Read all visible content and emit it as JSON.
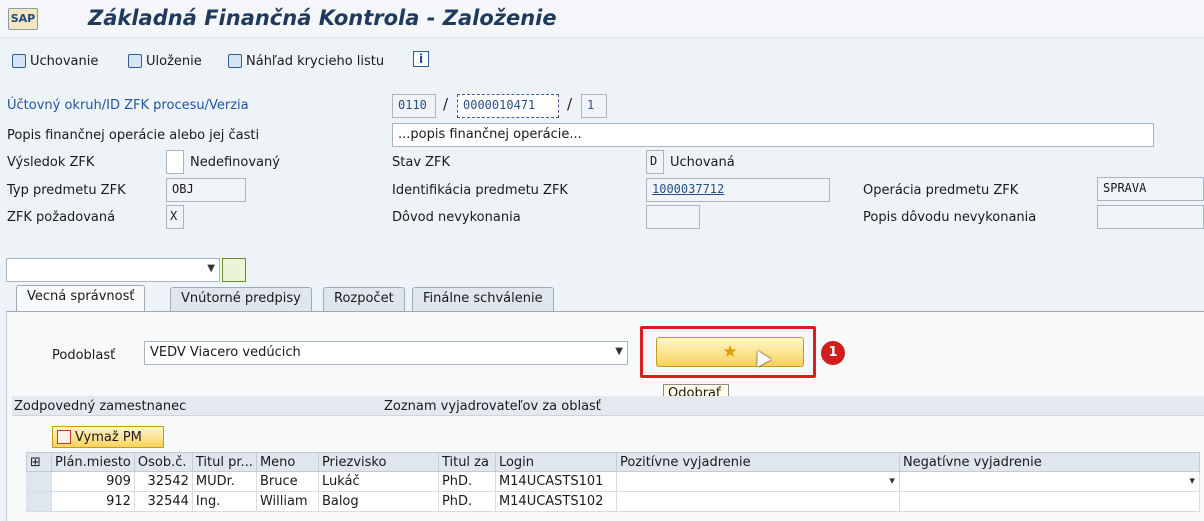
{
  "title": "Základná Finančná Kontrola - Založenie",
  "app_icon_label": "SAP",
  "toolbar": {
    "uchovanie": "Uchovanie",
    "ulozenie": "Uloženie",
    "nahlad": "Náhľad krycieho listu",
    "info": "i"
  },
  "form": {
    "okruh_label": "Účtovný okruh/ID ZFK procesu/Verzia",
    "okruh": "0110",
    "id_zfk": "0000010471",
    "verzia": "1",
    "sep": "/",
    "popis_label": "Popis finančnej operácie alebo jej časti",
    "popis": "...popis finančnej operácie...",
    "vysledok_label": "Výsledok ZFK",
    "vysledok_text": "Nedefinovaný",
    "stav_label": "Stav ZFK",
    "stav_code": "D",
    "stav_text": "Uchovaná",
    "typ_label": "Typ predmetu ZFK",
    "typ": "OBJ",
    "ident_label": "Identifikácia predmetu ZFK",
    "ident": "1000037712",
    "operacia_label": "Operácia predmetu ZFK",
    "operacia": "SPRAVA",
    "pozadovana_label": "ZFK požadovaná",
    "pozadovana": "X",
    "dovod_label": "Dôvod nevykonania",
    "popis_dovodu_label": "Popis dôvodu nevykonania"
  },
  "tabs": [
    "Vecná správnosť",
    "Vnútorné predpisy",
    "Rozpočet",
    "Finálne schválenie"
  ],
  "podoblast_label": "Podoblasť",
  "podoblast_value": "VEDV Viacero vedúcich",
  "star_icon": "★",
  "badge": "1",
  "tooltip": "Odobrať",
  "section": {
    "col1": "Zodpovedný zamestnanec",
    "col2": "Zoznam vyjadrovateľov za oblasť"
  },
  "vymaz_label": "Vymaž PM",
  "grid": {
    "headers": [
      "Plán.miesto",
      "Osob.č.",
      "Titul pr...",
      "Meno",
      "Priezvisko",
      "Titul za",
      "Login",
      "Pozitívne vyjadrenie",
      "Negatívne vyjadrenie"
    ],
    "rows": [
      [
        "909",
        "32542",
        "MUDr.",
        "Bruce",
        "Lukáč",
        "PhD.",
        "M14UCASTS101",
        "",
        ""
      ],
      [
        "912",
        "32544",
        "Ing.",
        "William",
        "Balog",
        "PhD.",
        "M14UCASTS102",
        "",
        ""
      ]
    ]
  }
}
